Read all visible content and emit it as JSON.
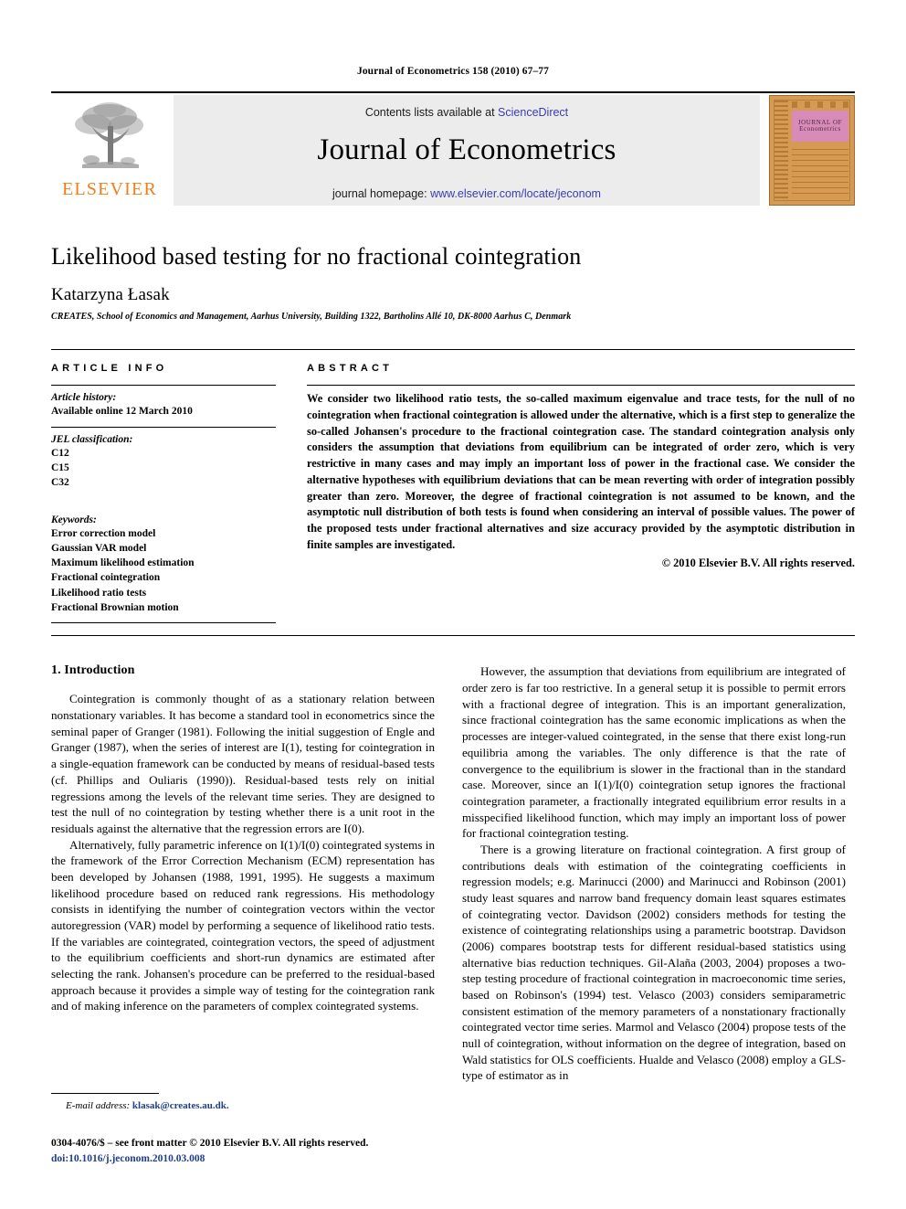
{
  "running_head": "Journal of Econometrics 158 (2010) 67–77",
  "masthead": {
    "contents_prefix": "Contents lists available at ",
    "sciencedirect": "ScienceDirect",
    "journal_name": "Journal of Econometrics",
    "homepage_prefix": "journal homepage: ",
    "homepage_url": "www.elsevier.com/locate/jeconom",
    "publisher_logo_text": "ELSEVIER",
    "cover_title_line1": "JOURNAL OF",
    "cover_title_line2": "Econometrics",
    "accent_orange": "#f07f1a",
    "link_blue": "#3b3bb0",
    "band_gray": "#ececec",
    "cover_orange": "#d79a52",
    "cover_pink": "#d88ab8"
  },
  "title_block": {
    "title": "Likelihood based testing for no fractional cointegration",
    "author": "Katarzyna Łasak",
    "affiliation": "CREATES, School of Economics and Management, Aarhus University, Building 1322, Bartholins Allé 10, DK-8000 Aarhus C, Denmark"
  },
  "article_info": {
    "heading": "ARTICLE INFO",
    "history_label": "Article history:",
    "history_items": [
      "Available online 12 March 2010"
    ],
    "jel_label": "JEL classification:",
    "jel_items": [
      "C12",
      "C15",
      "C32"
    ],
    "keywords_label": "Keywords:",
    "keywords": [
      "Error correction model",
      "Gaussian VAR model",
      "Maximum likelihood estimation",
      "Fractional cointegration",
      "Likelihood ratio tests",
      "Fractional Brownian motion"
    ]
  },
  "abstract": {
    "heading": "ABSTRACT",
    "text": "We consider two likelihood ratio tests, the so-called maximum eigenvalue and trace tests, for the null of no cointegration when fractional cointegration is allowed under the alternative, which is a first step to generalize the so-called Johansen's procedure to the fractional cointegration case. The standard cointegration analysis only considers the assumption that deviations from equilibrium can be integrated of order zero, which is very restrictive in many cases and may imply an important loss of power in the fractional case. We consider the alternative hypotheses with equilibrium deviations that can be mean reverting with order of integration possibly greater than zero. Moreover, the degree of fractional cointegration is not assumed to be known, and the asymptotic null distribution of both tests is found when considering an interval of possible values. The power of the proposed tests under fractional alternatives and size accuracy provided by the asymptotic distribution in finite samples are investigated.",
    "copyright": "© 2010 Elsevier B.V. All rights reserved."
  },
  "body": {
    "section_number_title": "1. Introduction",
    "left_paragraphs": [
      "Cointegration is commonly thought of as a stationary relation between nonstationary variables. It has become a standard tool in econometrics since the seminal paper of Granger (1981). Following the initial suggestion of Engle and Granger (1987), when the series of interest are I(1), testing for cointegration in a single-equation framework can be conducted by means of residual-based tests (cf. Phillips and Ouliaris (1990)). Residual-based tests rely on initial regressions among the levels of the relevant time series. They are designed to test the null of no cointegration by testing whether there is a unit root in the residuals against the alternative that the regression errors are I(0).",
      "Alternatively, fully parametric inference on I(1)/I(0) cointegrated systems in the framework of the Error Correction Mechanism (ECM) representation has been developed by Johansen (1988, 1991, 1995). He suggests a maximum likelihood procedure based on reduced rank regressions. His methodology consists in identifying the number of cointegration vectors within the vector autoregression (VAR) model by performing a sequence of likelihood ratio tests. If the variables are cointegrated, cointegration vectors, the speed of adjustment to the equilibrium coefficients and short-run dynamics are estimated after selecting the rank. Johansen's procedure can be preferred to the residual-based approach because it provides a simple way of testing for the cointegration rank and of making inference on the parameters of complex cointegrated systems."
    ],
    "right_paragraphs": [
      "However, the assumption that deviations from equilibrium are integrated of order zero is far too restrictive. In a general setup it is possible to permit errors with a fractional degree of integration. This is an important generalization, since fractional cointegration has the same economic implications as when the processes are integer-valued cointegrated, in the sense that there exist long-run equilibria among the variables. The only difference is that the rate of convergence to the equilibrium is slower in the fractional than in the standard case. Moreover, since an I(1)/I(0) cointegration setup ignores the fractional cointegration parameter, a fractionally integrated equilibrium error results in a misspecified likelihood function, which may imply an important loss of power for fractional cointegration testing.",
      "There is a growing literature on fractional cointegration. A first group of contributions deals with estimation of the cointegrating coefficients in regression models; e.g. Marinucci (2000) and Marinucci and Robinson (2001) study least squares and narrow band frequency domain least squares estimates of cointegrating vector. Davidson (2002) considers methods for testing the existence of cointegrating relationships using a parametric bootstrap. Davidson (2006) compares bootstrap tests for different residual-based statistics using alternative bias reduction techniques. Gil-Alaña (2003, 2004) proposes a two-step testing procedure of fractional cointegration in macroeconomic time series, based on Robinson's (1994) test. Velasco (2003) considers semiparametric consistent estimation of the memory parameters of a nonstationary fractionally cointegrated vector time series. Marmol and Velasco (2004) propose tests of the null of cointegration, without information on the degree of integration, based on Wald statistics for OLS coefficients. Hualde and Velasco (2008) employ a GLS-type of estimator as in"
    ]
  },
  "footnote": {
    "label": "E-mail address:",
    "email": "klasak@creates.au.dk."
  },
  "footer": {
    "line1": "0304-4076/$ – see front matter © 2010 Elsevier B.V. All rights reserved.",
    "doi": "doi:10.1016/j.jeconom.2010.03.008"
  }
}
